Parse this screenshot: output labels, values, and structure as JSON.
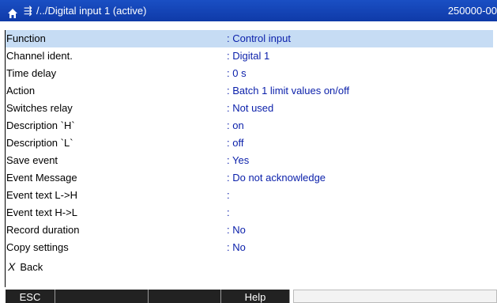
{
  "titlebar": {
    "home_icon": "home-icon",
    "nav_icon": "⇶",
    "path": "/../Digital input 1 (active)",
    "device_id": "250000-00"
  },
  "rows": [
    {
      "label": "Function",
      "value": ": Control input"
    },
    {
      "label": "Channel ident.",
      "value": ": Digital 1"
    },
    {
      "label": "Time delay",
      "value": ": 0 s"
    },
    {
      "label": "Action",
      "value": ": Batch 1 limit values on/off"
    },
    {
      "label": "Switches relay",
      "value": ": Not used"
    },
    {
      "label": "Description `H`",
      "value": ": on"
    },
    {
      "label": "Description `L`",
      "value": ": off"
    },
    {
      "label": "Save event",
      "value": ": Yes"
    },
    {
      "label": "Event Message",
      "value": ": Do not acknowledge"
    },
    {
      "label": "Event text L->H",
      "value": ":"
    },
    {
      "label": "Event text H->L",
      "value": ":"
    },
    {
      "label": "Record duration",
      "value": ": No"
    },
    {
      "label": "Copy settings",
      "value": ": No"
    }
  ],
  "back": {
    "x": "X",
    "label": "Back"
  },
  "softkeys": {
    "key1": "ESC",
    "key2": "",
    "key3": "",
    "key4": "Help",
    "key5": ""
  },
  "colors": {
    "titlebar": "#1a4fc4",
    "selected_row": "#c6dcf4",
    "value_text": "#0a1faa"
  }
}
